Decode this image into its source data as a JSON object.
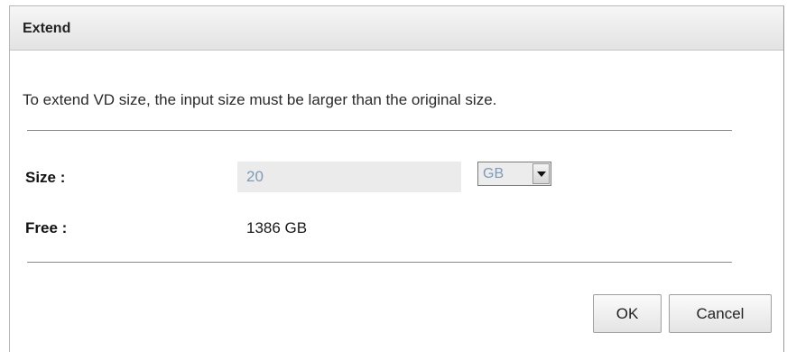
{
  "dialog": {
    "title": "Extend",
    "message": "To extend VD size, the input size must be larger than the original size."
  },
  "form": {
    "size_label": "Size :",
    "size_value": "20",
    "unit_value": "GB",
    "free_label": "Free :",
    "free_value": "1386 GB"
  },
  "buttons": {
    "ok": "OK",
    "cancel": "Cancel"
  },
  "colors": {
    "input_text": "#7f9ab8",
    "input_background": "#ebebeb",
    "titlebar": "#e3e3e3"
  },
  "icons": {
    "dropdown": "triangle-down"
  }
}
